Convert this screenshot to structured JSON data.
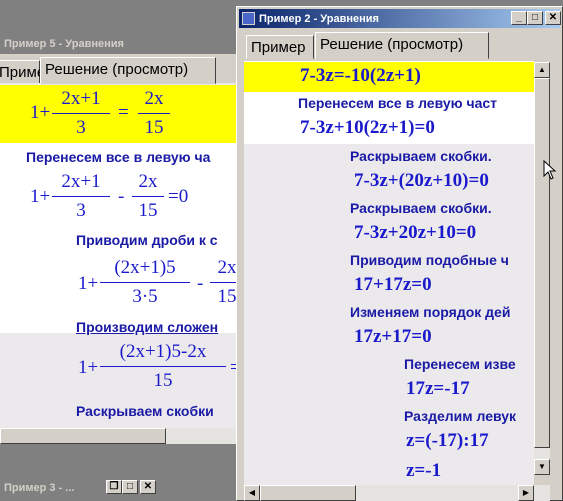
{
  "win5": {
    "title": "Пример 5 - Уравнения",
    "tab_example": "Пример",
    "tab_solution": "Решение (просмотр)",
    "eq_main": {
      "lhs_one": "1+",
      "num1": "2x+1",
      "den1": "3",
      "eq": "=",
      "num2": "2x",
      "den2": "15"
    },
    "step1_text": "Перенесем все в левую ча",
    "step1_math": {
      "one": "1+",
      "num1": "2x+1",
      "den1": "3",
      "minus": "-",
      "num2": "2x",
      "den2": "15",
      "tail": "=0"
    },
    "step2_text": "Приводим дроби к с",
    "step2_math": {
      "one": "1+",
      "num1": "(2x+1)5",
      "den1": "3·5",
      "minus": "-",
      "num2": "2x",
      "den2": "15"
    },
    "step3_text": "Производим сложен",
    "step3_math": {
      "one": "1+",
      "num1": "(2x+1)5-2x",
      "den1": "15",
      "tail": "="
    },
    "step4_text": "Раскрываем скобки"
  },
  "win3": {
    "title": "Пример 3 - ..."
  },
  "win2": {
    "title": "Пример 2 - Уравнения",
    "tab_example": "Пример",
    "tab_solution": "Решение (просмотр)",
    "lines": [
      {
        "kind": "math",
        "text": "7-3z=-10(2z+1)"
      },
      {
        "kind": "text",
        "text": "Перенесем все в левую част"
      },
      {
        "kind": "math",
        "text": "7-3z+10(2z+1)=0"
      },
      {
        "kind": "text",
        "text": "Раскрываем скобки."
      },
      {
        "kind": "math",
        "text": "7-3z+(20z+10)=0"
      },
      {
        "kind": "text",
        "text": "Раскрываем скобки."
      },
      {
        "kind": "math",
        "text": "7-3z+20z+10=0"
      },
      {
        "kind": "text",
        "text": "Приводим подобные ч"
      },
      {
        "kind": "math",
        "text": "17+17z=0"
      },
      {
        "kind": "text",
        "text": "Изменяем порядок дей"
      },
      {
        "kind": "math",
        "text": "17z+17=0"
      },
      {
        "kind": "text",
        "text": "Перенесем изве"
      },
      {
        "kind": "math",
        "text": "17z=-17"
      },
      {
        "kind": "text",
        "text": "Разделим левук"
      },
      {
        "kind": "math",
        "text": "z=(-17):17"
      },
      {
        "kind": "math",
        "text": "z=-1"
      }
    ]
  },
  "glyphs": {
    "minimize": "_",
    "maximize": "□",
    "restore": "❐",
    "close": "✕",
    "arrow_up": "▲",
    "arrow_down": "▼",
    "arrow_left": "◀",
    "arrow_right": "▶"
  }
}
